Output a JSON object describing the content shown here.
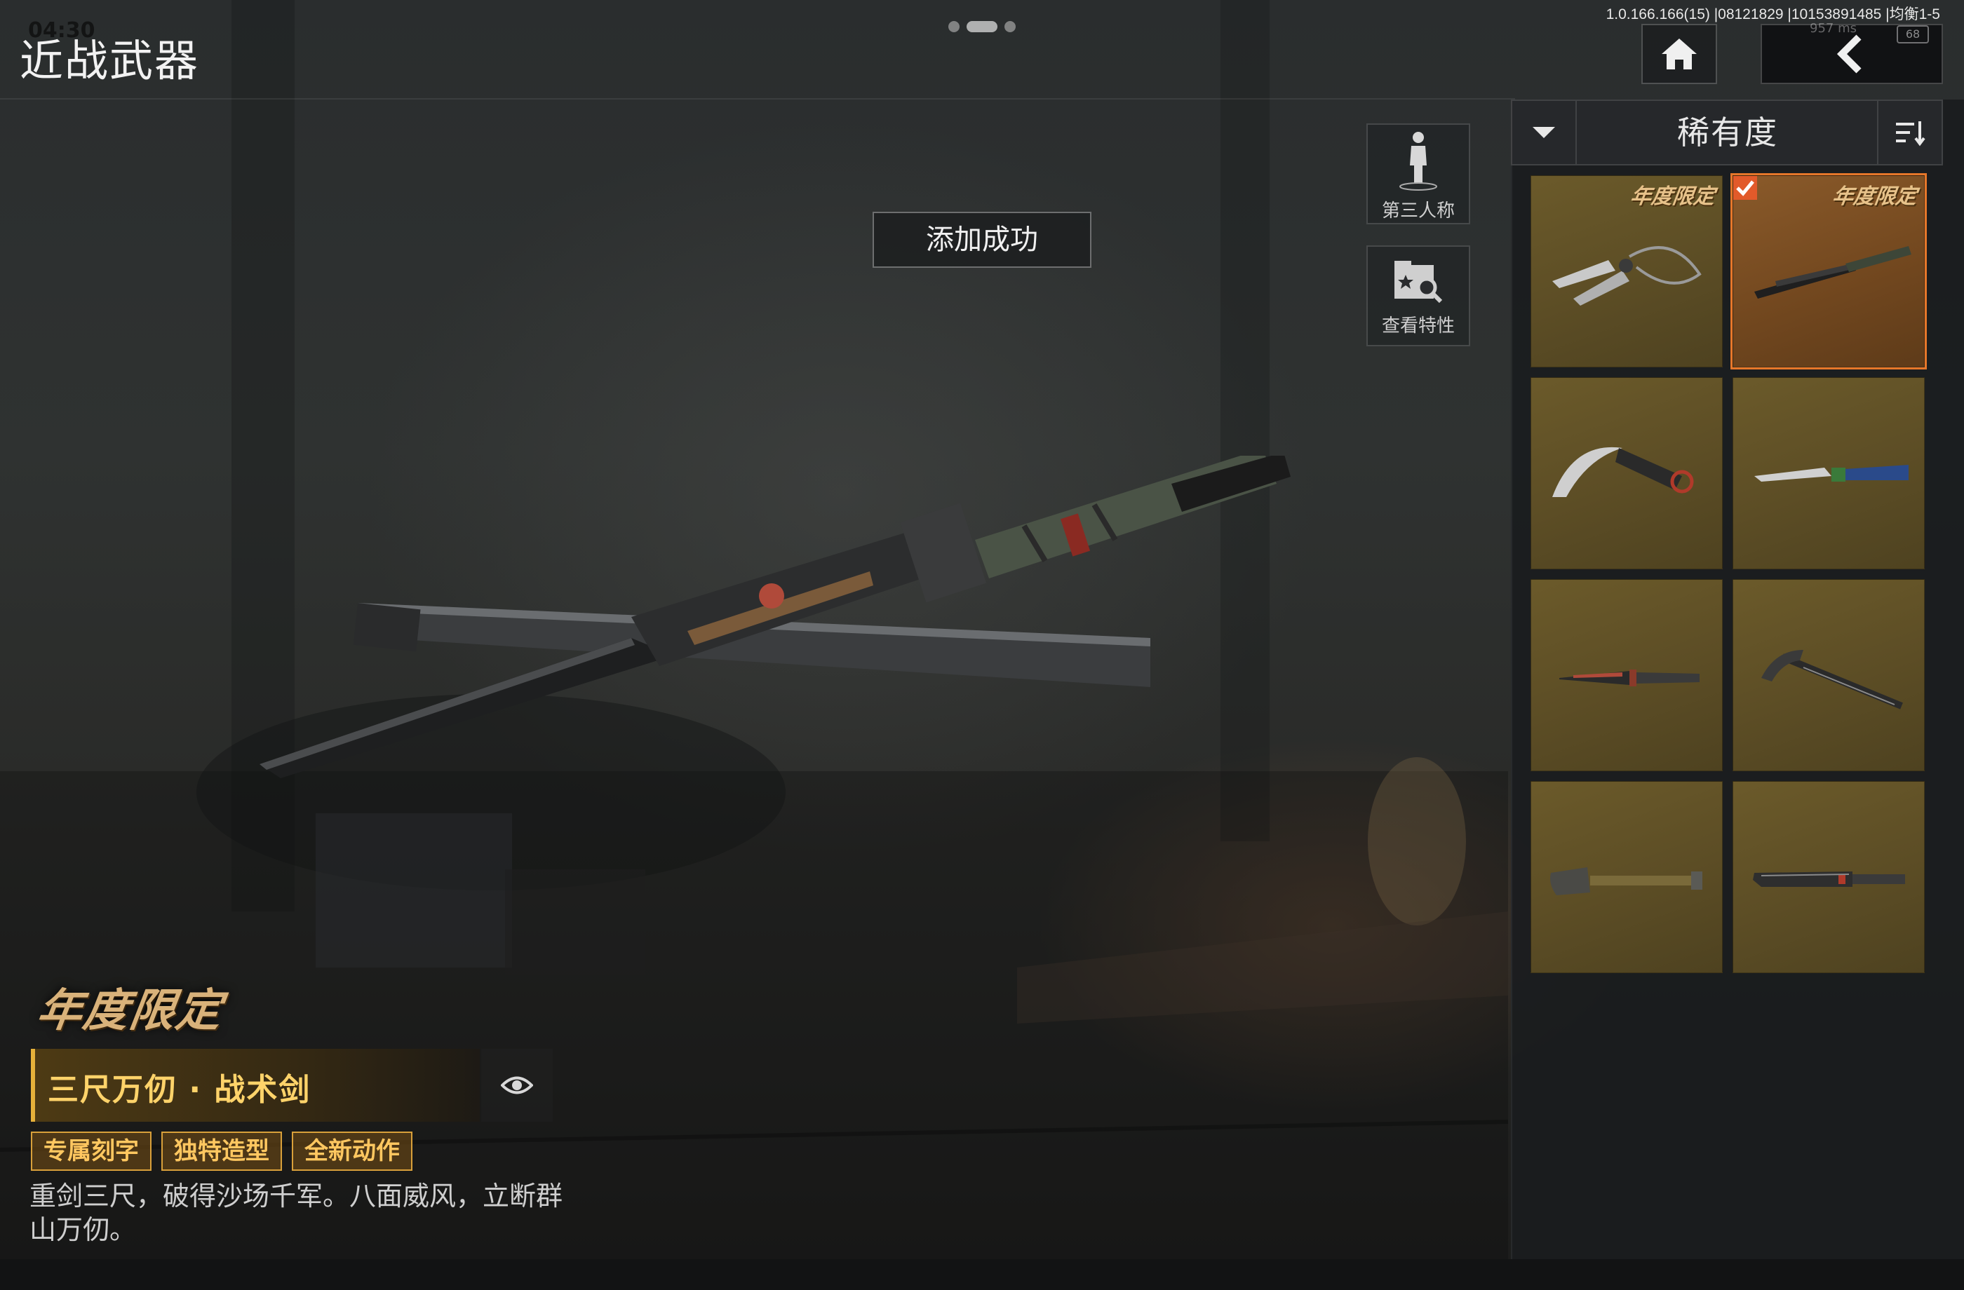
{
  "status": {
    "clock": "04:30",
    "build_info": "1.0.166.166(15) |08121829 |10153891485 |均衡1-5",
    "network": "957 ms",
    "battery": "68"
  },
  "header": {
    "title": "近战武器",
    "home_icon": "home-icon",
    "back_icon": "chevron-left-icon"
  },
  "side_buttons": {
    "third_person": "第三人称",
    "view_traits": "查看特性"
  },
  "toast": "添加成功",
  "weapon": {
    "annual_badge": "年度限定",
    "name": "三尺万仞 · 战术剑",
    "tags": [
      "专属刻字",
      "独特造型",
      "全新动作"
    ],
    "description": "重剑三尺，破得沙场千军。八面威风，立断群山万仞。"
  },
  "list": {
    "sort_label": "稀有度",
    "items": [
      {
        "icon": "dual-kunai-icon",
        "badge": "年度限定",
        "selected": false
      },
      {
        "icon": "tactical-sword-icon",
        "badge": "年度限定",
        "selected": true
      },
      {
        "icon": "karambit-icon",
        "badge": "",
        "selected": false
      },
      {
        "icon": "combat-knife-icon",
        "badge": "",
        "selected": false
      },
      {
        "icon": "bayonet-icon",
        "badge": "",
        "selected": false
      },
      {
        "icon": "pickaxe-icon",
        "badge": "",
        "selected": false
      },
      {
        "icon": "shovel-icon",
        "badge": "",
        "selected": false
      },
      {
        "icon": "machete-icon",
        "badge": "",
        "selected": false
      }
    ]
  },
  "colors": {
    "accent_gold": "#e6b13a",
    "selected_outline": "#e6772a",
    "cell_gold": "#6b5a2a"
  }
}
